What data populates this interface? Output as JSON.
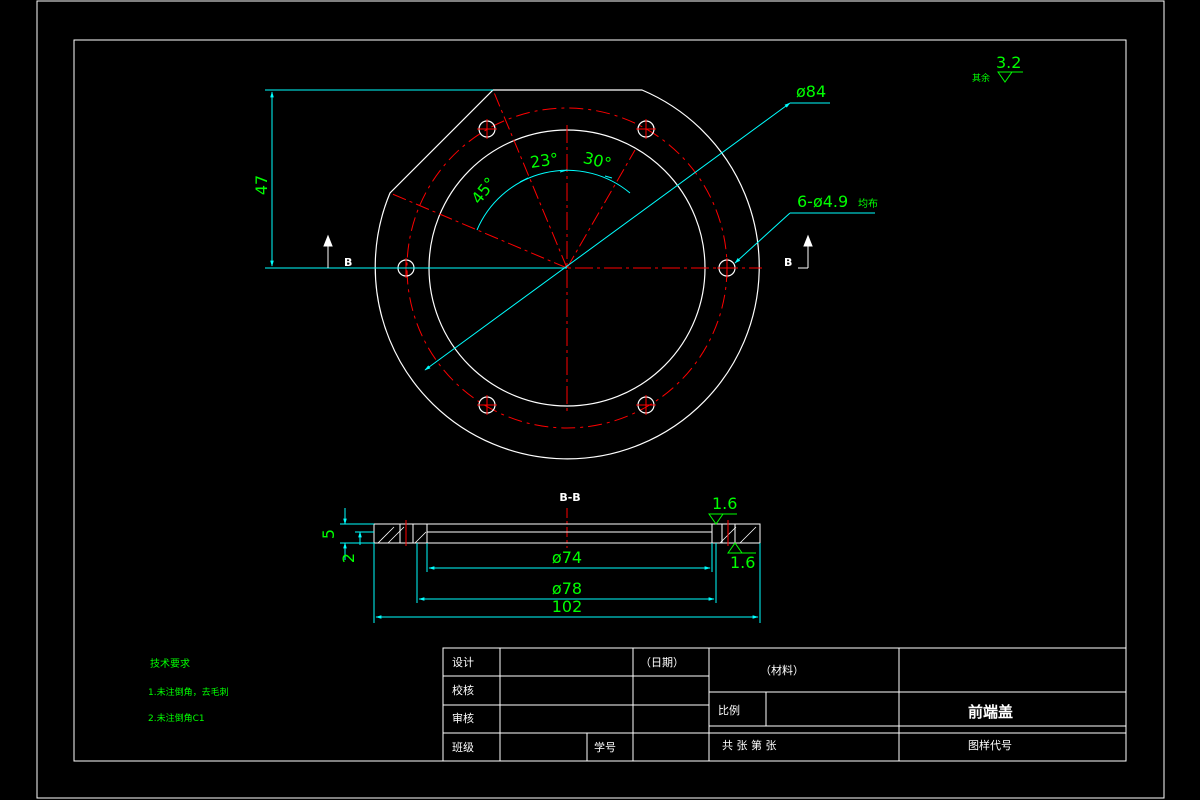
{
  "drawing": {
    "dimensions": {
      "height_47": "47",
      "dia_84": "ø84",
      "holes": "6-ø4.9",
      "holes_suffix": "均布",
      "angle_45": "45°",
      "angle_23": "23°",
      "angle_30": "30°",
      "thick_5": "5",
      "thick_2": "2",
      "dia_74": "ø74",
      "dia_78": "ø78",
      "width_102": "102",
      "rough_top": "1.6",
      "rough_bottom": "1.6",
      "rough_global": "3.2",
      "rough_global_label": "其余"
    },
    "section_marks": {
      "left": "B",
      "right": "B",
      "section_title": "B-B"
    }
  },
  "notes": {
    "title": "技术要求",
    "items": [
      "1.未注倒角，去毛刺",
      "2.未注倒角C1"
    ]
  },
  "title_block": {
    "design": "设计",
    "check": "校核",
    "review": "审核",
    "class": "班级",
    "student_no": "学号",
    "date": "（日期）",
    "material": "（材料）",
    "scale": "比例",
    "sheets": "共    张  第    张",
    "part_name": "前端盖",
    "drawing_no": "图样代号"
  },
  "colors": {
    "outline": "#ffffff",
    "centerline": "#ff0000",
    "dimension_line": "#00ffff",
    "dimension_text": "#00ff00"
  }
}
